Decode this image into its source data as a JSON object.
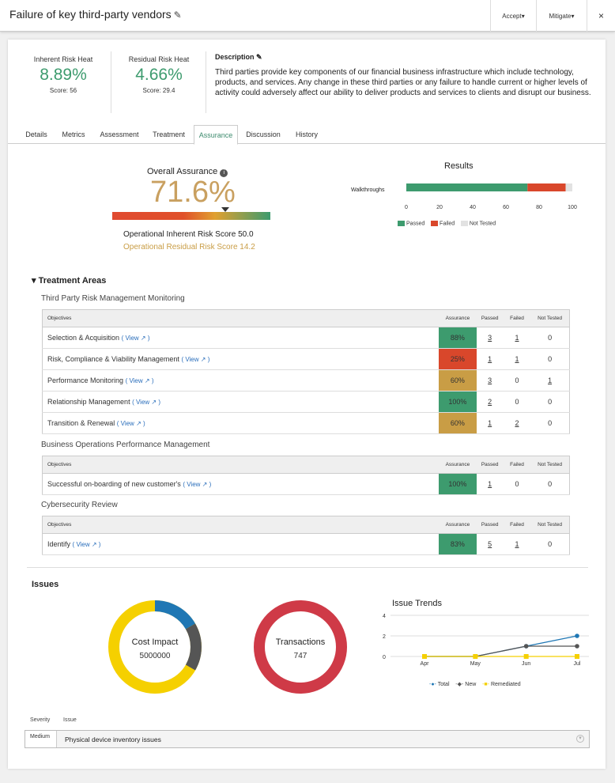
{
  "header": {
    "title": "Failure of key third-party vendors",
    "accept_label": "Accept▾",
    "mitigate_label": "Mitigate▾",
    "close_label": "×"
  },
  "risk": {
    "inherent": {
      "label": "Inherent Risk Heat",
      "value": "8.89%",
      "score": "Score: 56"
    },
    "residual": {
      "label": "Residual Risk Heat",
      "value": "4.66%",
      "score": "Score: 29.4"
    },
    "description_title": "Description",
    "description": "Third parties provide key components of our financial business infrastructure which include technology, products, and services. Any change in these third parties or any failure to handle current or higher levels of activity could adversely affect our ability to deliver products and services to clients and disrupt our business."
  },
  "tabs": [
    "Details",
    "Metrics",
    "Assessment",
    "Treatment",
    "Assurance",
    "Discussion",
    "History"
  ],
  "assurance": {
    "title": "Overall Assurance",
    "value": "71.6%",
    "level": 0.716,
    "inherent_score": "Operational Inherent Risk Score 50.0",
    "residual_score": "Operational Residual Risk Score 14.2"
  },
  "results": {
    "title": "Results",
    "category": "Walkthroughs",
    "passed": 73,
    "failed": 23,
    "not_tested": 4,
    "ticks": [
      "0",
      "20",
      "40",
      "60",
      "80",
      "100"
    ],
    "legend": [
      "Passed",
      "Failed",
      "Not Tested"
    ]
  },
  "treatment": {
    "title": "Treatment Areas",
    "columns": [
      "Objectives",
      "Assurance",
      "Passed",
      "Failed",
      "Not Tested"
    ],
    "groups": [
      {
        "name": "Third Party Risk Management Monitoring",
        "rows": [
          {
            "obj": "Selection & Acquisition",
            "assurance": "88%",
            "color": "#3d9b6e",
            "passed": "3",
            "failed": "1",
            "not_tested": "0"
          },
          {
            "obj": "Risk, Compliance & Viability Management",
            "assurance": "25%",
            "color": "#d9472b",
            "passed": "1",
            "failed": "1",
            "not_tested": "0"
          },
          {
            "obj": "Performance Monitoring",
            "assurance": "60%",
            "color": "#c99d45",
            "passed": "3",
            "failed": "0",
            "not_tested": "1"
          },
          {
            "obj": "Relationship Management",
            "assurance": "100%",
            "color": "#3d9b6e",
            "passed": "2",
            "failed": "0",
            "not_tested": "0"
          },
          {
            "obj": "Transition & Renewal",
            "assurance": "60%",
            "color": "#c99d45",
            "passed": "1",
            "failed": "2",
            "not_tested": "0"
          }
        ]
      },
      {
        "name": "Business Operations Performance Management",
        "rows": [
          {
            "obj": "Successful on-boarding of new customer's",
            "assurance": "100%",
            "color": "#3d9b6e",
            "passed": "1",
            "failed": "0",
            "not_tested": "0"
          }
        ]
      },
      {
        "name": "Cybersecurity Review",
        "rows": [
          {
            "obj": "Identify",
            "assurance": "83%",
            "color": "#3d9b6e",
            "passed": "5",
            "failed": "1",
            "not_tested": "0"
          }
        ]
      }
    ],
    "view_label": "View"
  },
  "issues": {
    "title": "Issues",
    "cost": {
      "label": "Cost Impact",
      "value": "5000000"
    },
    "transactions": {
      "label": "Transactions",
      "value": "747"
    },
    "trends": {
      "title": "Issue Trends",
      "months": [
        "Apr",
        "May",
        "Jun",
        "Jul"
      ],
      "yticks": [
        "4",
        "2",
        "0"
      ],
      "series": [
        {
          "name": "Total",
          "color": "#1f77b4",
          "values": [
            0,
            0,
            1,
            2
          ]
        },
        {
          "name": "New",
          "color": "#555555",
          "values": [
            0,
            0,
            1,
            1
          ]
        },
        {
          "name": "Remediated",
          "color": "#f5d000",
          "values": [
            0,
            0,
            0,
            0
          ]
        }
      ]
    },
    "columns": [
      "Severity",
      "Issue"
    ],
    "rows": [
      {
        "severity": "Medium",
        "issue": "Physical device inventory issues"
      }
    ]
  },
  "colors": {
    "green": "#3d9b6e",
    "red": "#d9472b",
    "gold": "#c99d45",
    "blue": "#2a6ebb"
  }
}
